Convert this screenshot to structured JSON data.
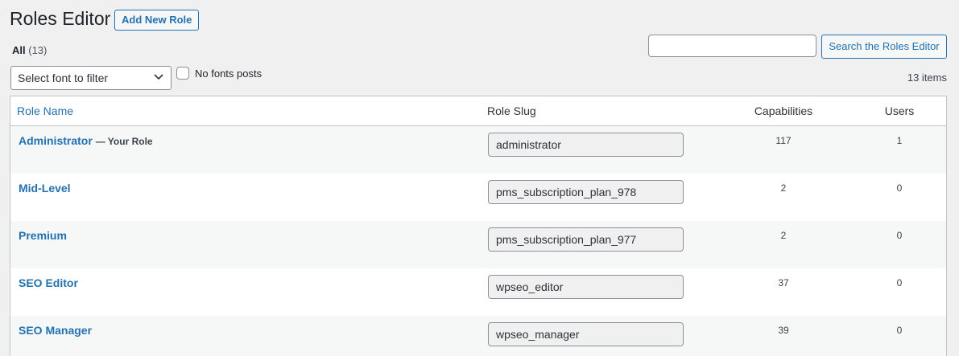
{
  "header": {
    "title": "Roles Editor",
    "add_new_label": "Add New Role"
  },
  "filters": {
    "all_label": "All",
    "all_count": "(13)",
    "font_select_value": "Select font to filter",
    "checkbox_label": "No fonts posts",
    "items_count": "13 items"
  },
  "search": {
    "value": "",
    "button_label": "Search the Roles Editor"
  },
  "table": {
    "columns": {
      "role_name": "Role Name",
      "role_slug": "Role Slug",
      "capabilities": "Capabilities",
      "users": "Users"
    },
    "rows": [
      {
        "name": "Administrator",
        "suffix": "— Your Role",
        "slug": "administrator",
        "capabilities": "117",
        "users": "1"
      },
      {
        "name": "Mid-Level",
        "suffix": "",
        "slug": "pms_subscription_plan_978",
        "capabilities": "2",
        "users": "0"
      },
      {
        "name": "Premium",
        "suffix": "",
        "slug": "pms_subscription_plan_977",
        "capabilities": "2",
        "users": "0"
      },
      {
        "name": "SEO Editor",
        "suffix": "",
        "slug": "wpseo_editor",
        "capabilities": "37",
        "users": "0"
      },
      {
        "name": "SEO Manager",
        "suffix": "",
        "slug": "wpseo_manager",
        "capabilities": "39",
        "users": "0"
      }
    ]
  },
  "icons": {
    "select_chevron": "chevron-down-icon"
  },
  "colors": {
    "accent": "#2271b1",
    "background": "#f0f0f1"
  }
}
